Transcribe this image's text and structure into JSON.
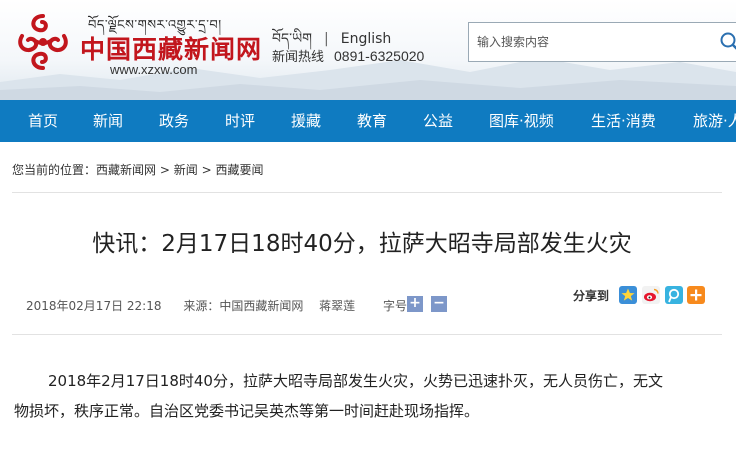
{
  "header": {
    "tibetan_name": "བོད་ལྗོངས་གསར་འགྱུར་དྲ་བ།",
    "site_name": "中国西藏新闻网",
    "site_url": "www.xzxw.com",
    "lang_tibetan": "བོད་ཡིག",
    "lang_english": "English",
    "hotline_label": "新闻热线",
    "hotline_number": "0891-6325020",
    "search_placeholder": "输入搜索内容"
  },
  "nav": {
    "items": [
      {
        "label": "首页"
      },
      {
        "label": "新闻"
      },
      {
        "label": "政务"
      },
      {
        "label": "时评"
      },
      {
        "label": "援藏"
      },
      {
        "label": "教育"
      },
      {
        "label": "公益"
      },
      {
        "label": "图库·视频"
      },
      {
        "label": "生活·消费"
      },
      {
        "label": "旅游·人"
      }
    ]
  },
  "breadcrumb": {
    "prefix": "您当前的位置：",
    "items": [
      "西藏新闻网",
      "新闻",
      "西藏要闻"
    ],
    "separator": ">"
  },
  "article": {
    "title": "快讯：2月17日18时40分，拉萨大昭寺局部发生火灾",
    "date": "2018年02月17日 22:18",
    "source_label": "来源：",
    "source": "中国西藏新闻网",
    "author": "蒋翠莲",
    "font_size_label": "字号：",
    "font_increase": "+",
    "font_decrease": "−",
    "share_label": "分享到",
    "body_line1": "2018年2月17日18时40分，拉萨大昭寺局部发生火灾，火势已迅速扑灭，无人员伤亡，无文",
    "body_line2": "物损坏，秩序正常。自治区党委书记吴英杰等第一时间赶赴现场指挥。"
  },
  "colors": {
    "nav_bg": "#0f7bc1",
    "logo_red": "#c2161d",
    "font_button": "#7d97c9"
  },
  "icons": [
    "search-icon",
    "qzone-share-icon",
    "weibo-share-icon",
    "tencent-weibo-share-icon",
    "more-share-icon"
  ]
}
